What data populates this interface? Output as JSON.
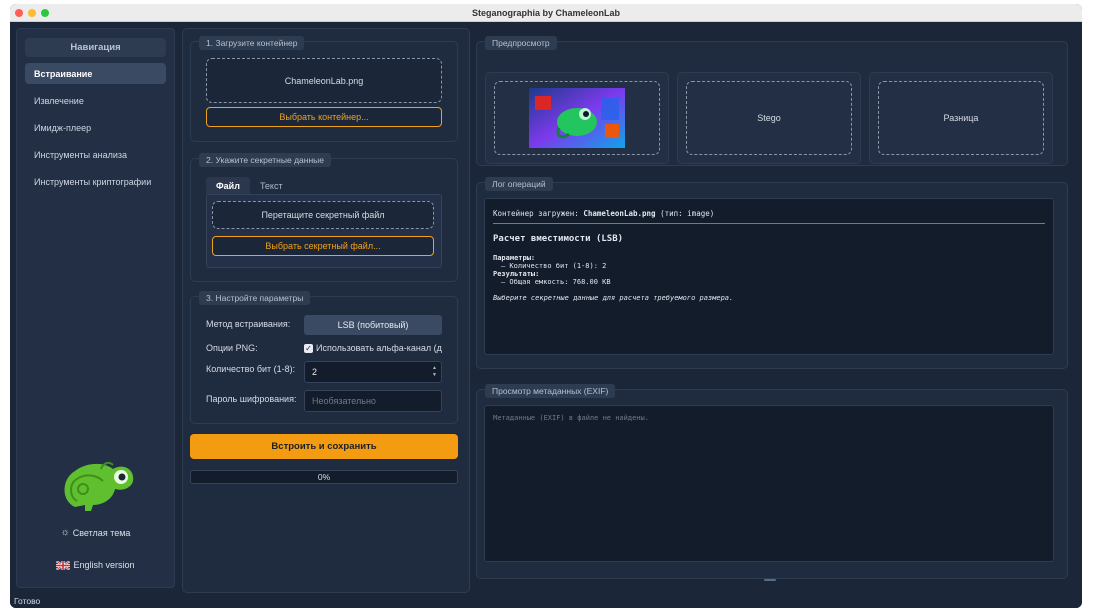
{
  "window": {
    "title": "Steganographia by ChameleonLab"
  },
  "sidebar": {
    "title": "Навигация",
    "items": [
      {
        "label": "Встраивание",
        "active": true
      },
      {
        "label": "Извлечение",
        "active": false
      },
      {
        "label": "Имидж-плеер",
        "active": false
      },
      {
        "label": "Инструменты анализа",
        "active": false
      },
      {
        "label": "Инструменты криптографии",
        "active": false
      }
    ],
    "theme_label": "Светлая тема",
    "language_label": "English version"
  },
  "step1": {
    "title": "1. Загрузите контейнер",
    "file_name": "ChameleonLab.png",
    "choose_label": "Выбрать контейнер..."
  },
  "step2": {
    "title": "2. Укажите секретные данные",
    "tabs": [
      "Файл",
      "Текст"
    ],
    "drop_label": "Перетащите секретный файл",
    "choose_label": "Выбрать секретный файл..."
  },
  "step3": {
    "title": "3. Настройте параметры",
    "method_label": "Метод встраивания:",
    "method_value": "LSB (побитовый)",
    "png_label": "Опции PNG:",
    "alpha_label": "Использовать альфа-канал (д",
    "bits_label": "Количество бит (1-8):",
    "bits_value": "2",
    "password_label": "Пароль шифрования:",
    "password_placeholder": "Необязательно"
  },
  "actions": {
    "embed_label": "Встроить и сохранить",
    "progress_label": "0%",
    "progress_value": 0
  },
  "preview": {
    "title": "Предпросмотр",
    "stego_label": "Stego",
    "diff_label": "Разница"
  },
  "log": {
    "title": "Лог операций",
    "line1_prefix": "Контейнер загружен: ",
    "line1_file": "ChameleonLab.png",
    "line1_suffix": " (тип: image)",
    "heading": "Расчет вместимости (LSB)",
    "params_label": "Параметры:",
    "params_line": "– Количество бит (1-8): 2",
    "results_label": "Результаты:",
    "results_line": "– Общая емкость: 768.00 KB",
    "hint": "Выберите секретные данные для расчета требуемого размера."
  },
  "exif": {
    "title": "Просмотр метаданных (EXIF)",
    "message": "Метаданные (EXIF) в файле не найдены."
  },
  "status": {
    "text": "Готово"
  },
  "colors": {
    "accent": "#f39c12",
    "background": "#1b2638",
    "panel": "#222f44"
  }
}
